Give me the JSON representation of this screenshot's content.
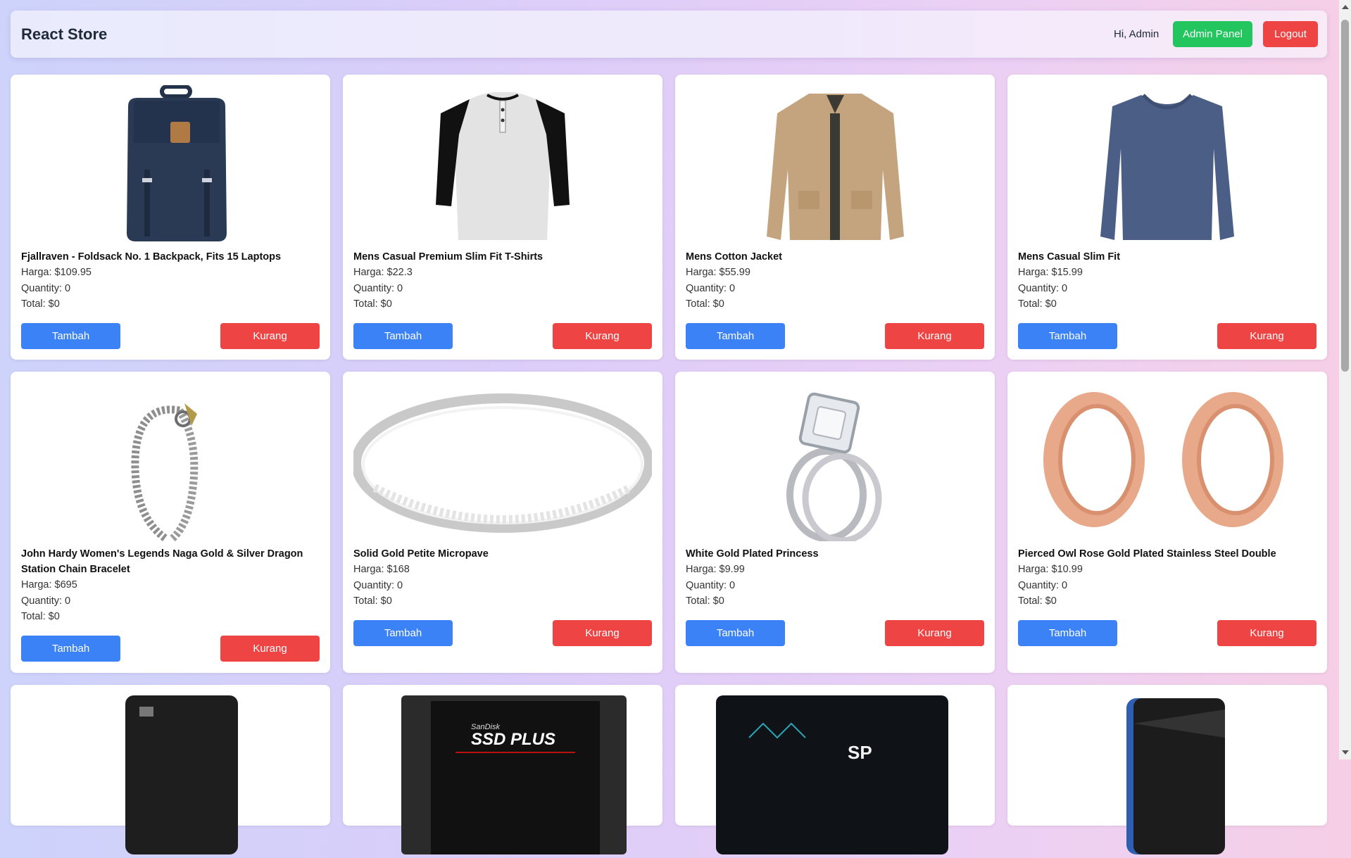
{
  "navbar": {
    "brand": "React Store",
    "greeting": "Hi, Admin",
    "admin_label": "Admin Panel",
    "logout_label": "Logout"
  },
  "colors": {
    "add": "#3b82f6",
    "subtract": "#ef4444",
    "admin": "#22c55e"
  },
  "buttons": {
    "add": "Tambah",
    "subtract": "Kurang"
  },
  "products": [
    {
      "title": "Fjallraven - Foldsack No. 1 Backpack, Fits 15 Laptops",
      "price": "Harga: $109.95",
      "quantity": "Quantity: 0",
      "total": "Total: $0",
      "image": "backpack"
    },
    {
      "title": "Mens Casual Premium Slim Fit T-Shirts",
      "price": "Harga: $22.3",
      "quantity": "Quantity: 0",
      "total": "Total: $0",
      "image": "raglan-tshirt"
    },
    {
      "title": "Mens Cotton Jacket",
      "price": "Harga: $55.99",
      "quantity": "Quantity: 0",
      "total": "Total: $0",
      "image": "jacket"
    },
    {
      "title": "Mens Casual Slim Fit",
      "price": "Harga: $15.99",
      "quantity": "Quantity: 0",
      "total": "Total: $0",
      "image": "longsleeve-shirt"
    },
    {
      "title": "John Hardy Women's Legends Naga Gold & Silver Dragon Station Chain Bracelet",
      "price": "Harga: $695",
      "quantity": "Quantity: 0",
      "total": "Total: $0",
      "image": "bracelet"
    },
    {
      "title": "Solid Gold Petite Micropave",
      "price": "Harga: $168",
      "quantity": "Quantity: 0",
      "total": "Total: $0",
      "image": "ring-band"
    },
    {
      "title": "White Gold Plated Princess",
      "price": "Harga: $9.99",
      "quantity": "Quantity: 0",
      "total": "Total: $0",
      "image": "engagement-ring"
    },
    {
      "title": "Pierced Owl Rose Gold Plated Stainless Steel Double",
      "price": "Harga: $10.99",
      "quantity": "Quantity: 0",
      "total": "Total: $0",
      "image": "ear-tunnels"
    },
    {
      "image": "external-drive"
    },
    {
      "image": "ssd-sandisk",
      "image_text": "SanDisk",
      "image_text2": "SSD PLUS"
    },
    {
      "image": "ssd-silicon-power",
      "image_text": "SP"
    },
    {
      "image": "portable-drive"
    }
  ]
}
